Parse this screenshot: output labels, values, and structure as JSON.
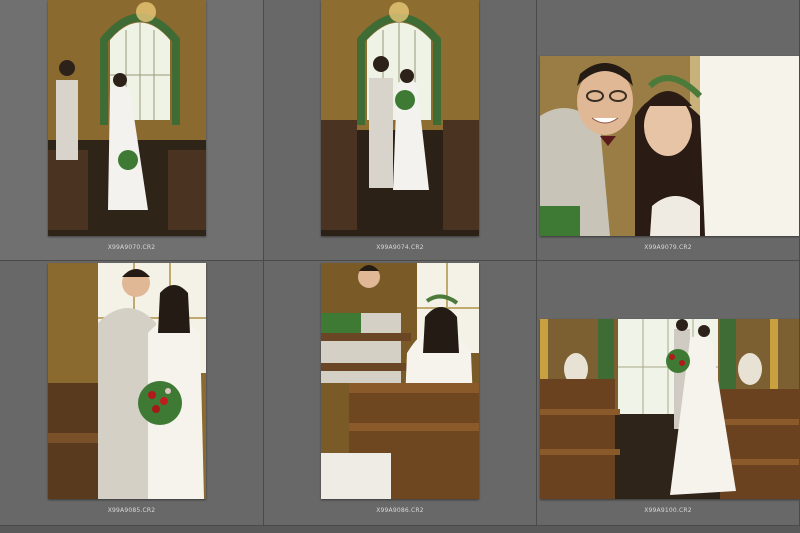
{
  "grid": {
    "cells": [
      {
        "filename": "X99A9070.CR2",
        "photo": "church-aisle-couple-walking"
      },
      {
        "filename": "X99A9074.CR2",
        "photo": "church-aisle-couple-standing"
      },
      {
        "filename": "X99A9079.CR2",
        "photo": "couple-closeup-smiling"
      },
      {
        "filename": "X99A9085.CR2",
        "photo": "couple-with-bouquet-by-window"
      },
      {
        "filename": "X99A9086.CR2",
        "photo": "bride-seated-on-pew"
      },
      {
        "filename": "X99A9100.CR2",
        "photo": "church-interior-wide-couple"
      }
    ]
  },
  "colors": {
    "panel": "#686868",
    "background": "#5f5f5f",
    "label": "#d8d8d8"
  }
}
